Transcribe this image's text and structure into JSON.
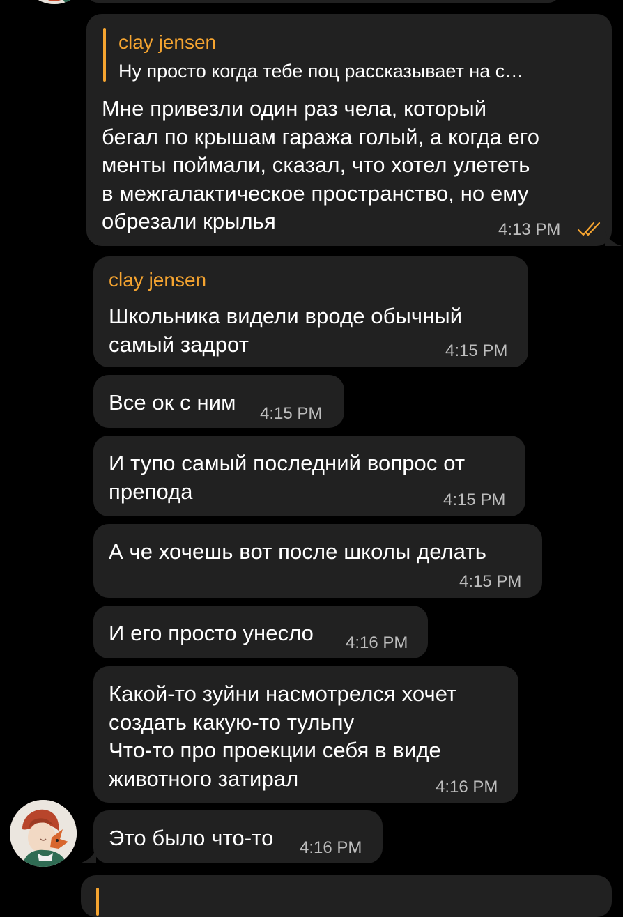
{
  "messages": [
    {
      "id": "m1",
      "reply": {
        "sender": "clay jensen",
        "text": "Ну просто когда тебе поц рассказывает на с…"
      },
      "text": "Мне привезли один раз чела, который\nбегал по крышам гаража голый, а когда его\nменты поймали, сказал, что хотел улететь\nв межгалактическое пространство, но ему\nобрезали крылья",
      "time": "4:13 PM",
      "status_icon": "double-check-icon"
    },
    {
      "id": "m2",
      "sender": "clay jensen",
      "text": "Школьника видели вроде обычный\nсамый задрот",
      "time": "4:15 PM"
    },
    {
      "id": "m3",
      "text": "Все ок с ним",
      "time": "4:15 PM"
    },
    {
      "id": "m4",
      "text": "И тупо самый последний вопрос от\nпрепода",
      "time": "4:15 PM"
    },
    {
      "id": "m5",
      "text": "А че хочешь вот после школы делать",
      "time": "4:15 PM"
    },
    {
      "id": "m6",
      "text": "И его просто унесло",
      "time": "4:16 PM"
    },
    {
      "id": "m7",
      "text": "Какой-то зуйни насмотрелся хочет\nсоздать какую-то тульпу\nЧто-то про проекции себя в виде\nживотного затирал",
      "time": "4:16 PM"
    },
    {
      "id": "m8",
      "text": "Это было что-то",
      "time": "4:16 PM",
      "avatar_icon": "user-avatar-fox-illustration"
    }
  ],
  "colors": {
    "background": "#000000",
    "bubble": "#212121",
    "accent": "#f5a430",
    "time": "#bdbdbd"
  }
}
